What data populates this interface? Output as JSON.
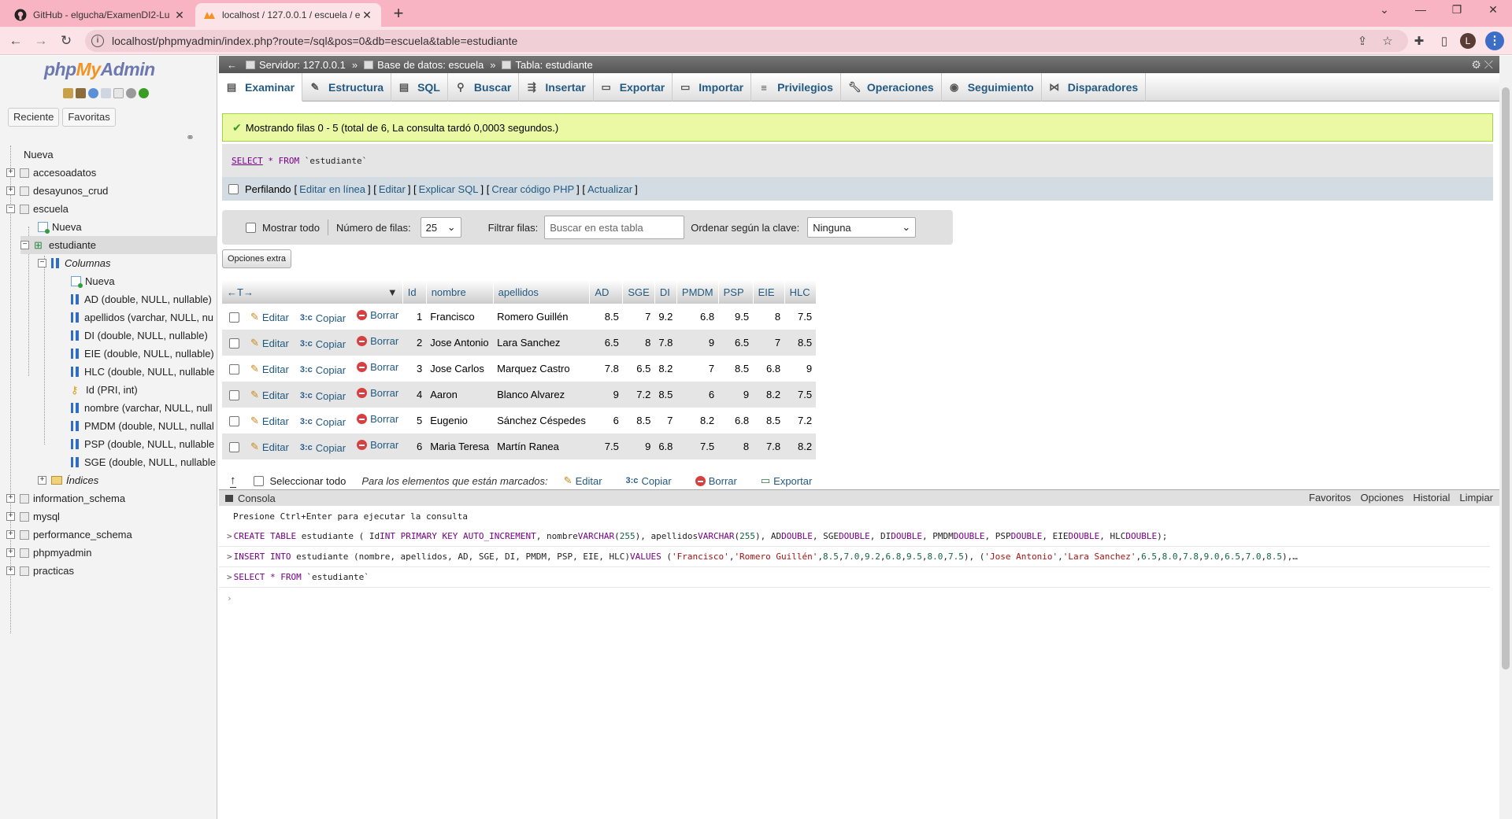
{
  "browser": {
    "tabs": [
      {
        "title": "GitHub - elgucha/ExamenDI2-Lu",
        "close": "✕"
      },
      {
        "title": "localhost / 127.0.0.1 / escuela / e",
        "close": "✕"
      }
    ],
    "url": "localhost/phpmyadmin/index.php?route=/sql&pos=0&db=escuela&table=estudiante",
    "profile_initial": "L"
  },
  "leftpanel": {
    "logo_a": "php",
    "logo_b": "My",
    "logo_c": "Admin",
    "tab_recent": "Reciente",
    "tab_favorites": "Favoritas",
    "tree": {
      "nueva_root": "Nueva",
      "db1": "accesoadatos",
      "db2": "desayunos_crud",
      "db3": "escuela",
      "escuela_nueva": "Nueva",
      "table": "estudiante",
      "columnas": "Columnas",
      "col_nueva": "Nueva",
      "columns": [
        "AD (double, NULL, nullable)",
        "apellidos (varchar, NULL, nu",
        "DI (double, NULL, nullable)",
        "EIE (double, NULL, nullable)",
        "HLC (double, NULL, nullable",
        "Id (PRI, int)",
        "nombre (varchar, NULL, null",
        "PMDM (double, NULL, nullal",
        "PSP (double, NULL, nullable",
        "SGE (double, NULL, nullable"
      ],
      "indices": "Índices",
      "db4": "information_schema",
      "db5": "mysql",
      "db6": "performance_schema",
      "db7": "phpmyadmin",
      "db8": "practicas"
    }
  },
  "breadcrumb": {
    "server": "Servidor: 127.0.0.1",
    "database": "Base de datos: escuela",
    "table": "Tabla: estudiante",
    "sep": "»"
  },
  "menu": [
    "Examinar",
    "Estructura",
    "SQL",
    "Buscar",
    "Insertar",
    "Exportar",
    "Importar",
    "Privilegios",
    "Operaciones",
    "Seguimiento",
    "Disparadores"
  ],
  "success_msg": "Mostrando filas 0 - 5 (total de 6, La consulta tardó 0,0003 segundos.)",
  "sql": {
    "select": "SELECT",
    "star": " * ",
    "from": "FROM",
    "table": " `estudiante`"
  },
  "profiling": {
    "label": "Perfilando",
    "links": [
      "Editar en línea",
      "Editar",
      "Explicar SQL",
      "Crear código PHP",
      "Actualizar"
    ]
  },
  "navform": {
    "show_all": "Mostrar todo",
    "rows_label": "Número de filas:",
    "rows_value": "25",
    "filter_label": "Filtrar filas:",
    "filter_placeholder": "Buscar en esta tabla",
    "order_label": "Ordenar según la clave:",
    "order_value": "Ninguna"
  },
  "extra_options": "Opciones extra",
  "table": {
    "arrows": "←T→",
    "headers": [
      "Id",
      "nombre",
      "apellidos",
      "AD",
      "SGE",
      "DI",
      "PMDM",
      "PSP",
      "EIE",
      "HLC"
    ],
    "actions": {
      "edit": "Editar",
      "copy": "Copiar",
      "delete": "Borrar"
    },
    "rows": [
      [
        "1",
        "Francisco",
        "Romero Guillén",
        "8.5",
        "7",
        "9.2",
        "6.8",
        "9.5",
        "8",
        "7.5"
      ],
      [
        "2",
        "Jose Antonio",
        "Lara Sanchez",
        "6.5",
        "8",
        "7.8",
        "9",
        "6.5",
        "7",
        "8.5"
      ],
      [
        "3",
        "Jose Carlos",
        "Marquez Castro",
        "7.8",
        "6.5",
        "8.2",
        "7",
        "8.5",
        "6.8",
        "9"
      ],
      [
        "4",
        "Aaron",
        "Blanco Alvarez",
        "9",
        "7.2",
        "8.5",
        "6",
        "9",
        "8.2",
        "7.5"
      ],
      [
        "5",
        "Eugenio",
        "Sánchez Céspedes",
        "6",
        "8.5",
        "7",
        "8.2",
        "6.8",
        "8.5",
        "7.2"
      ],
      [
        "6",
        "Maria Teresa",
        "Martín Ranea",
        "7.5",
        "9",
        "6.8",
        "7.5",
        "8",
        "7.8",
        "8.2"
      ]
    ]
  },
  "bulk": {
    "select_all": "Seleccionar todo",
    "marked_label": "Para los elementos que están marcados:",
    "edit": "Editar",
    "copy": "Copiar",
    "delete": "Borrar",
    "export": "Exportar"
  },
  "console": {
    "title": "Consola",
    "links": [
      "Favoritos",
      "Opciones",
      "Historial",
      "Limpiar"
    ],
    "hint": "Presione Ctrl+Enter para ejecutar la consulta",
    "prompt": ">"
  }
}
